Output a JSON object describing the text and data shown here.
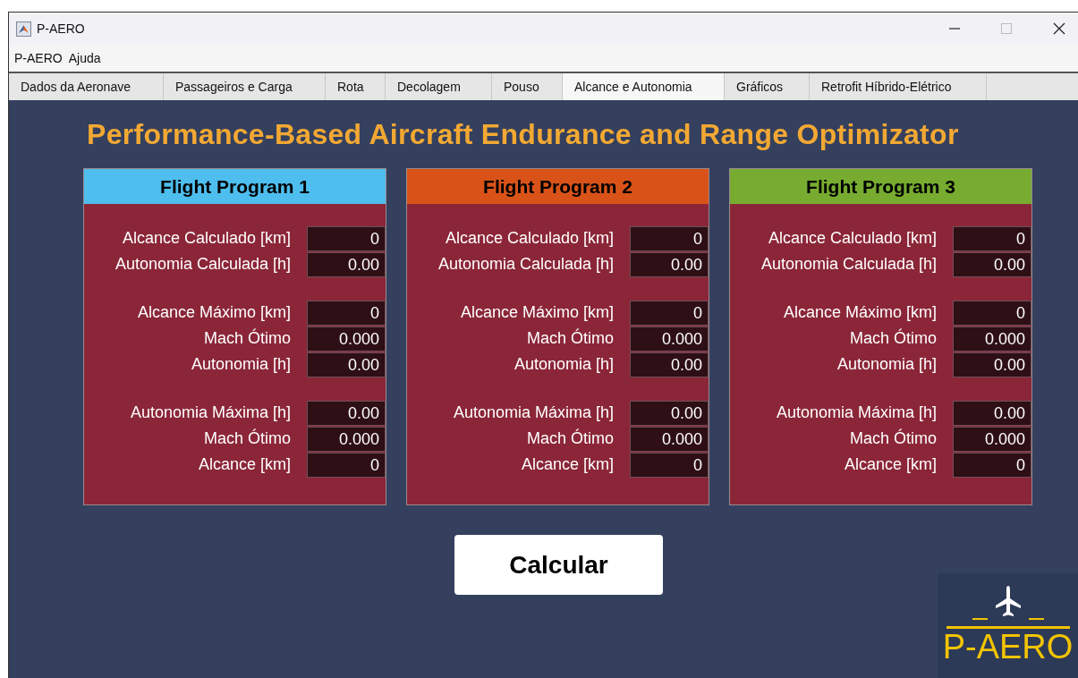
{
  "window": {
    "title": "P-AERO"
  },
  "menu": [
    "P-AERO",
    "Ajuda"
  ],
  "tabs": [
    {
      "label": "Dados da Aeronave",
      "selected": false
    },
    {
      "label": "Passageiros e Carga",
      "selected": false
    },
    {
      "label": "Rota",
      "selected": false
    },
    {
      "label": "Decolagem",
      "selected": false
    },
    {
      "label": "Pouso",
      "selected": false
    },
    {
      "label": "Alcance e Autonomia",
      "selected": true
    },
    {
      "label": "Gráficos",
      "selected": false
    },
    {
      "label": "Retrofit Híbrido-Elétrico",
      "selected": false
    }
  ],
  "heading": "Performance-Based Aircraft Endurance and Range Optimizator",
  "programs": [
    {
      "title": "Flight Program 1",
      "color": "#4dbeee",
      "groups": [
        [
          {
            "label": "Alcance Calculado [km]",
            "value": "0"
          },
          {
            "label": "Autonomia Calculada [h]",
            "value": "0.00"
          }
        ],
        [
          {
            "label": "Alcance Máximo [km]",
            "value": "0"
          },
          {
            "label": "Mach Ótimo",
            "value": "0.000"
          },
          {
            "label": "Autonomia [h]",
            "value": "0.00"
          }
        ],
        [
          {
            "label": "Autonomia Máxima [h]",
            "value": "0.00"
          },
          {
            "label": "Mach Ótimo",
            "value": "0.000"
          },
          {
            "label": "Alcance [km]",
            "value": "0"
          }
        ]
      ]
    },
    {
      "title": "Flight Program 2",
      "color": "#d95319",
      "groups": [
        [
          {
            "label": "Alcance Calculado [km]",
            "value": "0"
          },
          {
            "label": "Autonomia Calculada [h]",
            "value": "0.00"
          }
        ],
        [
          {
            "label": "Alcance Máximo [km]",
            "value": "0"
          },
          {
            "label": "Mach Ótimo",
            "value": "0.000"
          },
          {
            "label": "Autonomia [h]",
            "value": "0.00"
          }
        ],
        [
          {
            "label": "Autonomia Máxima [h]",
            "value": "0.00"
          },
          {
            "label": "Mach Ótimo",
            "value": "0.000"
          },
          {
            "label": "Alcance [km]",
            "value": "0"
          }
        ]
      ]
    },
    {
      "title": "Flight Program 3",
      "color": "#77ac30",
      "groups": [
        [
          {
            "label": "Alcance Calculado [km]",
            "value": "0"
          },
          {
            "label": "Autonomia Calculada [h]",
            "value": "0.00"
          }
        ],
        [
          {
            "label": "Alcance Máximo [km]",
            "value": "0"
          },
          {
            "label": "Mach Ótimo",
            "value": "0.000"
          },
          {
            "label": "Autonomia [h]",
            "value": "0.00"
          }
        ],
        [
          {
            "label": "Autonomia Máxima [h]",
            "value": "0.00"
          },
          {
            "label": "Mach Ótimo",
            "value": "0.000"
          },
          {
            "label": "Alcance [km]",
            "value": "0"
          }
        ]
      ]
    }
  ],
  "button": "Calcular",
  "logo": {
    "text": "P-AERO"
  }
}
